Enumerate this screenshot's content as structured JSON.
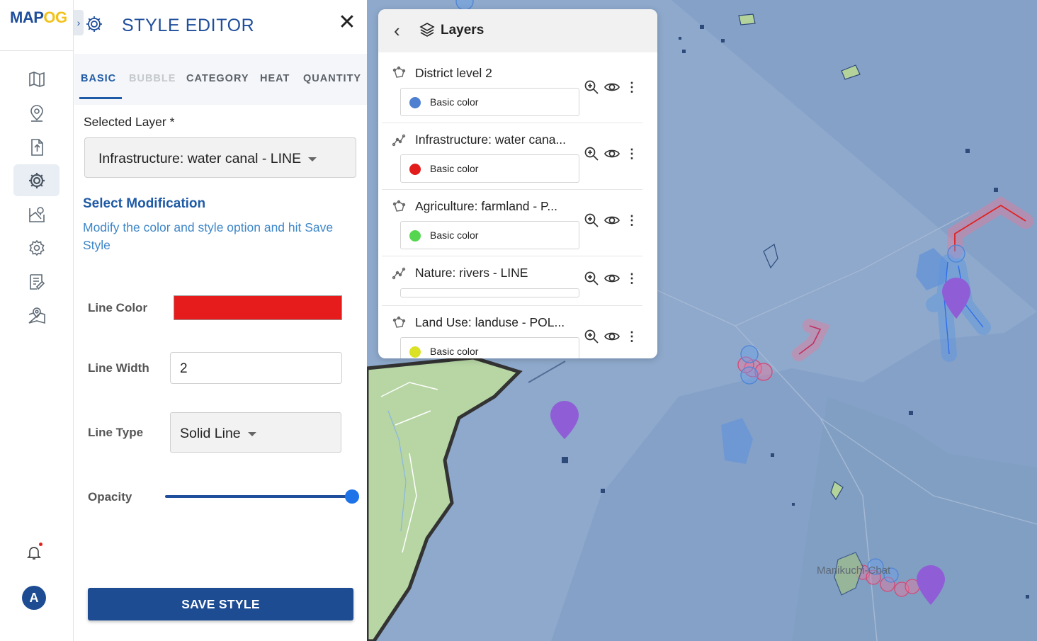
{
  "app": {
    "logo_text_a": "MAP",
    "logo_text_b": "OG"
  },
  "editor": {
    "title": "STYLE EDITOR",
    "close_glyph": "✕",
    "tabs": [
      {
        "label": "BASIC",
        "state": "active"
      },
      {
        "label": "BUBBLE",
        "state": "disabled"
      },
      {
        "label": "CATEGORY",
        "state": "normal"
      },
      {
        "label": "HEAT",
        "state": "normal"
      },
      {
        "label": "QUANTITY",
        "state": "normal"
      }
    ],
    "selected_layer_label": "Selected Layer *",
    "selected_layer_value": "Infrastructure: water canal - LINE",
    "section_title": "Select Modification",
    "section_desc": "Modify the color and style option and hit Save Style",
    "line_color_label": "Line Color",
    "line_color_value": "#e61c1c",
    "line_width_label": "Line Width",
    "line_width_value": "2",
    "line_type_label": "Line Type",
    "line_type_value": "Solid Line",
    "opacity_label": "Opacity",
    "opacity_value": 1.0,
    "save_label": "SAVE STYLE"
  },
  "rail": {
    "items": [
      {
        "icon": "map-icon"
      },
      {
        "icon": "location-pin-icon"
      },
      {
        "icon": "upload-icon"
      },
      {
        "icon": "gear-icon",
        "active": true
      },
      {
        "icon": "map-pin-icon"
      },
      {
        "icon": "settings-icon"
      },
      {
        "icon": "report-icon"
      },
      {
        "icon": "map-location-icon"
      }
    ],
    "avatar_letter": "A",
    "notification_dot": true
  },
  "layers_panel": {
    "title": "Layers",
    "layers": [
      {
        "name": "District level 2",
        "color_label": "Basic color",
        "color": "#4f7fd0",
        "geom": "polygon"
      },
      {
        "name": "Infrastructure: water cana...",
        "color_label": "Basic color",
        "color": "#e21b1b",
        "geom": "line"
      },
      {
        "name": "Agriculture: farmland - P...",
        "color_label": "Basic color",
        "color": "#56d650",
        "geom": "polygon"
      },
      {
        "name": "Nature: rivers - LINE",
        "color_label": "",
        "color": "",
        "geom": "line"
      },
      {
        "name": "Land Use: landuse - POL...",
        "color_label": "Basic color",
        "color": "#dbe124",
        "geom": "polygon"
      }
    ]
  },
  "map": {
    "place_label": "Manikuchi-Chat"
  }
}
